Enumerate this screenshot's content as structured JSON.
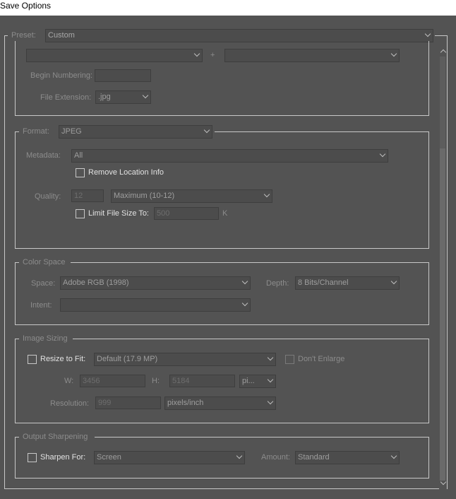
{
  "window": {
    "title": "Save Options"
  },
  "preset": {
    "label": "Preset:",
    "value": "Custom"
  },
  "naming": {
    "plus": "+",
    "begin_numbering_label": "Begin Numbering:",
    "begin_numbering_value": "",
    "file_extension_label": "File Extension:",
    "file_extension_value": ".jpg"
  },
  "format": {
    "label": "Format:",
    "value": "JPEG",
    "metadata_label": "Metadata:",
    "metadata_value": "All",
    "remove_location_label": "Remove Location Info",
    "quality_label": "Quality:",
    "quality_value": "12",
    "quality_range": "Maximum  (10-12)",
    "limit_size_label": "Limit File Size To:",
    "limit_size_value": "500",
    "limit_size_unit": "K"
  },
  "color_space": {
    "title": "Color Space",
    "space_label": "Space:",
    "space_value": "Adobe RGB (1998)",
    "depth_label": "Depth:",
    "depth_value": "8 Bits/Channel",
    "intent_label": "Intent:",
    "intent_value": ""
  },
  "image_sizing": {
    "title": "Image Sizing",
    "resize_label": "Resize to Fit:",
    "resize_value": "Default  (17.9 MP)",
    "dont_enlarge_label": "Don't Enlarge",
    "w_label": "W:",
    "w_value": "3456",
    "h_label": "H:",
    "h_value": "5184",
    "unit_value": "pi...",
    "resolution_label": "Resolution:",
    "resolution_value": "999",
    "resolution_unit": "pixels/inch"
  },
  "output_sharpening": {
    "title": "Output Sharpening",
    "sharpen_label": "Sharpen For:",
    "sharpen_value": "Screen",
    "amount_label": "Amount:",
    "amount_value": "Standard"
  }
}
